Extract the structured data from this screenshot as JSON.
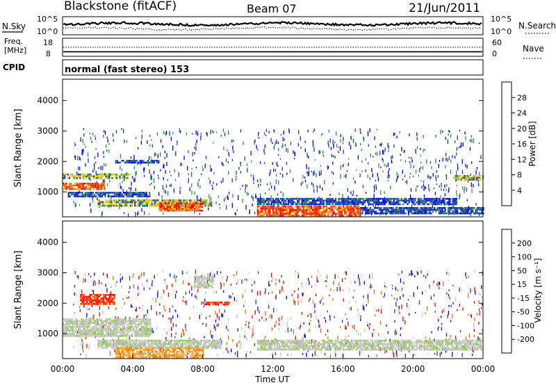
{
  "header": {
    "station": "Blackstone (fitACF)",
    "beam": "Beam 07",
    "date": "21/Jun/2011"
  },
  "strips": {
    "nsky_label": "N.Sky",
    "nsky_ticks": [
      "10^5",
      "10^0"
    ],
    "nsearch_label": "N.Search",
    "nsearch_ticks": [
      "10^5",
      "10^0"
    ],
    "freq_label_1": "Freq.",
    "freq_label_2": "[MHz]",
    "freq_ticks": [
      "18",
      "8"
    ],
    "nave_label": "Nave",
    "nave_ticks": [
      "60",
      "0"
    ],
    "cpid_label": "CPID",
    "cpid_text": "normal (fast stereo) 153"
  },
  "chart_data": [
    {
      "type": "heatmap",
      "name": "power",
      "ylabel": "Slant Range [km]",
      "yticks": [
        "1000",
        "2000",
        "3000",
        "4000"
      ],
      "ylim": [
        180,
        4700
      ],
      "colorbar_label": "Power [dB]",
      "colorbar_ticks": [
        "28",
        "24",
        "20",
        "16",
        "12",
        "8",
        "4"
      ],
      "colorbar_colors": [
        "#ff0000",
        "#ff6a00",
        "#ffa500",
        "#ffd000",
        "#80d040",
        "#2e8b57",
        "#1f3fa8",
        "#0000ff"
      ],
      "bands": [
        {
          "t0": 0.0,
          "t1": 3.8,
          "r0": 1450,
          "r1": 1600,
          "level": "mid"
        },
        {
          "t0": 0.0,
          "t1": 2.4,
          "r0": 1100,
          "r1": 1300,
          "level": "high"
        },
        {
          "t0": 0.3,
          "t1": 5.0,
          "r0": 850,
          "r1": 1000,
          "level": "low"
        },
        {
          "t0": 2.0,
          "t1": 8.5,
          "r0": 550,
          "r1": 750,
          "level": "mid"
        },
        {
          "t0": 5.5,
          "t1": 8.0,
          "r0": 400,
          "r1": 650,
          "level": "high"
        },
        {
          "t0": 11.1,
          "t1": 22.5,
          "r0": 600,
          "r1": 800,
          "level": "low"
        },
        {
          "t0": 11.1,
          "t1": 17.0,
          "r0": 250,
          "r1": 550,
          "level": "high"
        },
        {
          "t0": 17.0,
          "t1": 24.0,
          "r0": 300,
          "r1": 500,
          "level": "low"
        },
        {
          "t0": 22.3,
          "t1": 24.0,
          "r0": 1400,
          "r1": 1550,
          "level": "mid"
        },
        {
          "t0": 3.0,
          "t1": 5.5,
          "r0": 1950,
          "r1": 2050,
          "level": "low"
        }
      ],
      "xlabel": "",
      "xlim": [
        0,
        24
      ]
    },
    {
      "type": "heatmap",
      "name": "velocity",
      "ylabel": "Slant Range [km]",
      "yticks": [
        "1000",
        "2000",
        "3000",
        "4000"
      ],
      "ylim": [
        180,
        4700
      ],
      "colorbar_label": "Velocity [m s⁻¹]",
      "colorbar_ticks": [
        "200",
        "100",
        "50",
        "15",
        "-15",
        "-50",
        "-100",
        "-200"
      ],
      "colorbar_colors": [
        "#0000ff",
        "#1f3fa8",
        "#2e8b57",
        "#80d040",
        "#c8c8c0",
        "#ffa500",
        "#ff6a00",
        "#ff0000"
      ],
      "bands": [
        {
          "t0": 0.0,
          "t1": 5.0,
          "r0": 1300,
          "r1": 1500,
          "level": "gray"
        },
        {
          "t0": 0.0,
          "t1": 5.0,
          "r0": 900,
          "r1": 1250,
          "level": "gray"
        },
        {
          "t0": 2.0,
          "t1": 9.0,
          "r0": 550,
          "r1": 800,
          "level": "gray"
        },
        {
          "t0": 3.0,
          "t1": 8.0,
          "r0": 200,
          "r1": 550,
          "level": "orange"
        },
        {
          "t0": 11.1,
          "t1": 24.0,
          "r0": 500,
          "r1": 800,
          "level": "gray"
        },
        {
          "t0": 1.0,
          "t1": 3.0,
          "r0": 1950,
          "r1": 2300,
          "level": "red"
        },
        {
          "t0": 7.5,
          "t1": 8.6,
          "r0": 2500,
          "r1": 2900,
          "level": "gray"
        },
        {
          "t0": 8.0,
          "t1": 9.5,
          "r0": 1950,
          "r1": 2050,
          "level": "red"
        }
      ],
      "xlabel": "Time UT",
      "xlim": [
        0,
        24
      ],
      "xticks": [
        "00:00",
        "04:00",
        "08:00",
        "12:00",
        "16:00",
        "20:00",
        "00:00"
      ]
    }
  ],
  "colors": {
    "frame": "#000000",
    "background": "#ffffff"
  }
}
